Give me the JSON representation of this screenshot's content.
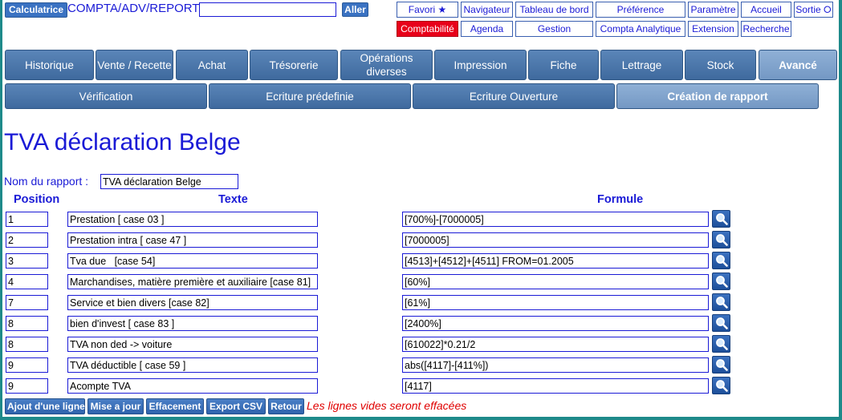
{
  "topbar": {
    "calc_label": "Calculatrice",
    "app_path": "COMPTA/ADV/REPORT",
    "search_value": "",
    "go_label": "Aller"
  },
  "nav_row1": [
    "Favori ★",
    "Navigateur",
    "Tableau de bord",
    "Préférence",
    "Paramètre",
    "Accueil",
    "Sortie ⭘"
  ],
  "nav_row2": [
    "Comptabilité",
    "Agenda",
    "Gestion",
    "Compta Analytique",
    "Extension",
    "Recherche"
  ],
  "tabs_main": [
    "Historique",
    "Vente / Recette",
    "Achat",
    "Trésorerie",
    "Opérations diverses",
    "Impression",
    "Fiche",
    "Lettrage",
    "Stock",
    "Avancé"
  ],
  "tabs_sub": [
    "Vérification",
    "Ecriture prédefinie",
    "Ecriture Ouverture",
    "Création de rapport"
  ],
  "page": {
    "title": "TVA déclaration Belge",
    "report_label": "Nom du rapport :",
    "report_name": "TVA déclaration Belge"
  },
  "columns": {
    "position": "Position",
    "text": "Texte",
    "formula": "Formule"
  },
  "rows": [
    {
      "position": "1",
      "text": "Prestation [ case 03 ]",
      "formula": "[700%]-[7000005]"
    },
    {
      "position": "2",
      "text": "Prestation intra [ case 47 ]",
      "formula": "[7000005]"
    },
    {
      "position": "3",
      "text": "Tva due   [case 54]",
      "formula": "[4513]+[4512]+[4511] FROM=01.2005"
    },
    {
      "position": "4",
      "text": "Marchandises, matière première et auxiliaire [case 81]",
      "formula": "[60%]"
    },
    {
      "position": "7",
      "text": "Service et bien divers [case 82]",
      "formula": "[61%]"
    },
    {
      "position": "8",
      "text": "bien d'invest [ case 83 ]",
      "formula": "[2400%]"
    },
    {
      "position": "8",
      "text": "TVA non ded -> voiture",
      "formula": "[610022]*0.21/2"
    },
    {
      "position": "9",
      "text": "TVA déductible [ case 59 ]",
      "formula": "abs([4117]-[411%])"
    },
    {
      "position": "9",
      "text": "Acompte TVA",
      "formula": "[4117]"
    }
  ],
  "actions": {
    "add_line": "Ajout d'une ligne",
    "save": "Mise a jour",
    "erase": "Effacement",
    "export": "Export CSV",
    "back": "Retour",
    "warning": "Les lignes vides seront effacées"
  },
  "icons": {
    "zoom": "magnifier-icon"
  },
  "colors": {
    "link_blue": "#1a1ad6",
    "active_red": "#e8001a",
    "tab_blue": "#4a76aa",
    "warning_red": "#e00000"
  }
}
